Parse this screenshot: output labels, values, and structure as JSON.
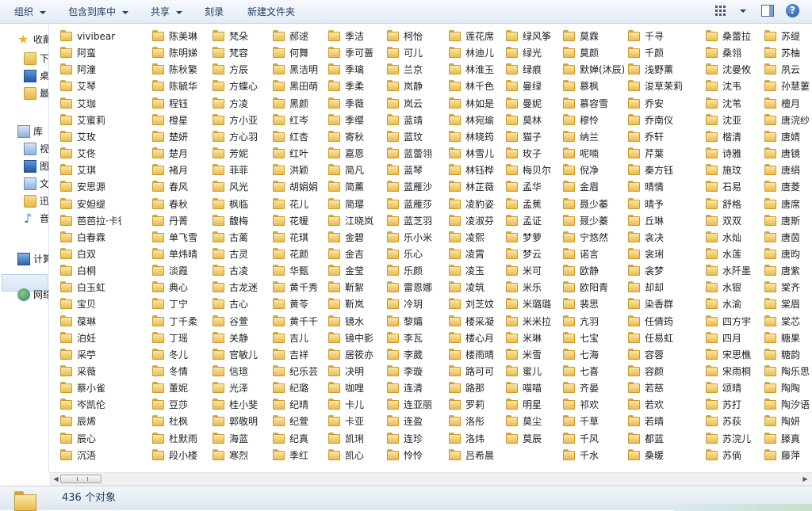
{
  "toolbar": {
    "organize": "组织",
    "include_library": "包含到库中",
    "share": "共享",
    "burn": "刻录",
    "new_folder": "新建文件夹",
    "help": "?"
  },
  "nav": {
    "favorites": "收藏夹",
    "fav_downloads": "下载",
    "fav_desktop": "桌面",
    "fav_recent": "最近访问的位置",
    "libraries": "库",
    "lib_videos": "视频",
    "lib_pictures": "图片",
    "lib_docs": "文档",
    "lib_thunder": "迅雷下载",
    "lib_music": "音乐",
    "computer": "计算机",
    "network": "网络"
  },
  "columns": [
    [
      "vivibear",
      "阿蛮",
      "阿潼",
      "艾琴",
      "艾珈",
      "艾蜜莉",
      "艾玫",
      "艾佟",
      "艾琪",
      "安思源",
      "安妲缇",
      "芭芭拉·卡德兰",
      "白春霖",
      "白双",
      "白桐",
      "白玉虹",
      "宝贝",
      "葆琳",
      "泊妊",
      "采苧",
      "采薇",
      "蔡小雀",
      "岑凯伦",
      "辰烯",
      "辰心",
      "沉浯"
    ],
    [
      "陈美琳",
      "陈明娣",
      "陈秋繁",
      "陈毓华",
      "程钰",
      "橙星",
      "楚妍",
      "楚月",
      "褚月",
      "春风",
      "春秋",
      "丹菁",
      "单飞雪",
      "单炜晴",
      "淡霞",
      "典心",
      "丁宁",
      "丁千柔",
      "丁瑶",
      "冬儿",
      "冬情",
      "董妮",
      "豆莎",
      "杜枫",
      "杜默雨",
      "段小楼"
    ],
    [
      "梵朵",
      "梵容",
      "方辰",
      "方蝶心",
      "方凌",
      "方小亚",
      "方心羽",
      "芳妮",
      "菲菲",
      "风光",
      "枫临",
      "馥梅",
      "古蓠",
      "古灵",
      "古凌",
      "古龙迷",
      "古心",
      "谷萱",
      "关静",
      "官敏儿",
      "信瑄",
      "光泽",
      "桂小斐",
      "郭敬明",
      "海蓝",
      "寒烈"
    ],
    [
      "郝逑",
      "何舞",
      "黑洁明",
      "黑田萌",
      "黑颜",
      "红岑",
      "红杏",
      "红叶",
      "洪颖",
      "胡娟娟",
      "花儿",
      "花暖",
      "花琪",
      "花颜",
      "华甄",
      "黄千秀",
      "黄苓",
      "黄千千",
      "吉儿",
      "吉祥",
      "纪乐芸",
      "纪璐",
      "纪晴",
      "纪萱",
      "纪真",
      "季红"
    ],
    [
      "季洁",
      "季可蔷",
      "季璃",
      "季柔",
      "季薇",
      "季缨",
      "寄秋",
      "嘉恩",
      "简凡",
      "简薰",
      "简璎",
      "江晓岚",
      "金碧",
      "金吉",
      "金莹",
      "靳絮",
      "靳岚",
      "镜水",
      "镜中影",
      "居筱亦",
      "决明",
      "咖哩",
      "卡儿",
      "卡亚",
      "凯琍",
      "凯心"
    ],
    [
      "柯怡",
      "可儿",
      "兰京",
      "岚静",
      "岚云",
      "蓝靖",
      "蓝玟",
      "蓝蕾翎",
      "蓝琴",
      "蓝雁沙",
      "蓝雁莎",
      "蓝芝羽",
      "乐小米",
      "乐心",
      "乐颜",
      "雷恩娜",
      "冷玥",
      "黎孀",
      "李瓦",
      "李葳",
      "李璇",
      "连清",
      "连亚丽",
      "连盈",
      "连珍",
      "怜怜"
    ],
    [
      "莲花席",
      "林迪儿",
      "林淮玉",
      "林千色",
      "林如是",
      "林宛瑜",
      "林晓筠",
      "林雪儿",
      "林钰桦",
      "林芷薇",
      "凌豹姿",
      "凌淑芬",
      "凌熙",
      "凌霄",
      "凌玉",
      "凌筑",
      "刘芝妏",
      "楼采凝",
      "楼心月",
      "楼雨晴",
      "路可可",
      "路那",
      "罗莉",
      "洛彤",
      "洛炜",
      "吕希晨"
    ],
    [
      "绿风筝",
      "绿光",
      "绿痕",
      "曼绿",
      "曼妮",
      "莫林",
      "猫子",
      "玫子",
      "梅贝尔",
      "孟华",
      "孟蕉",
      "孟证",
      "梦萝",
      "梦云",
      "米可",
      "米乐",
      "米璐璐",
      "米米拉",
      "米琳",
      "米雪",
      "蜜儿",
      "喵喵",
      "明星",
      "莫尘",
      "莫辰"
    ],
    [
      "莫霖",
      "莫颜",
      "默婵(沐辰)",
      "慕枫",
      "慕容雪",
      "穆怜",
      "纳兰",
      "呢喃",
      "倪净",
      "金眉",
      "聂少蓁",
      "聂少蓁",
      "宁悠然",
      "诺言",
      "欧静",
      "欧阳青",
      "裴思",
      "亢羽",
      "七宝",
      "七海",
      "七喜",
      "齐晏",
      "祁欢",
      "千草",
      "千风",
      "千水"
    ],
    [
      "千寻",
      "千颜",
      "浅野薰",
      "浚草茉莉",
      "乔安",
      "乔南仪",
      "乔轩",
      "芹葉",
      "秦方钰",
      "晴情",
      "晴予",
      "丘琳",
      "衾决",
      "衾琍",
      "衾梦",
      "却却",
      "染香群",
      "任倩筠",
      "任易虹",
      "容蓉",
      "容颜",
      "若慈",
      "若欢",
      "若晴",
      "都蓝",
      "桑暖"
    ],
    [
      "桑蕾拉",
      "桑翎",
      "沈曼攸",
      "沈韦",
      "沈苇",
      "沈亚",
      "楷清",
      "诗雅",
      "施玟",
      "石易",
      "舒格",
      "双双",
      "水灿",
      "水莲",
      "水阡墨",
      "水银",
      "水渝",
      "四方宇",
      "四月",
      "宋思樵",
      "宋雨桐",
      "颂晴",
      "苏打",
      "苏荻",
      "苏浣儿",
      "苏倘"
    ],
    [
      "苏缇",
      "苏柚",
      "夙云",
      "孙慧萋",
      "檀月",
      "唐浣纱",
      "唐婧",
      "唐镜",
      "唐绢",
      "唐菱",
      "唐席",
      "唐斯",
      "唐茵",
      "唐昀",
      "唐紫",
      "棠齐",
      "棠眉",
      "棠芯",
      "糖果",
      "糖韵",
      "陶乐思",
      "陶陶",
      "陶汐语",
      "陶妍",
      "滕真",
      "藤萍"
    ]
  ],
  "status": {
    "count": "436 个对象"
  }
}
